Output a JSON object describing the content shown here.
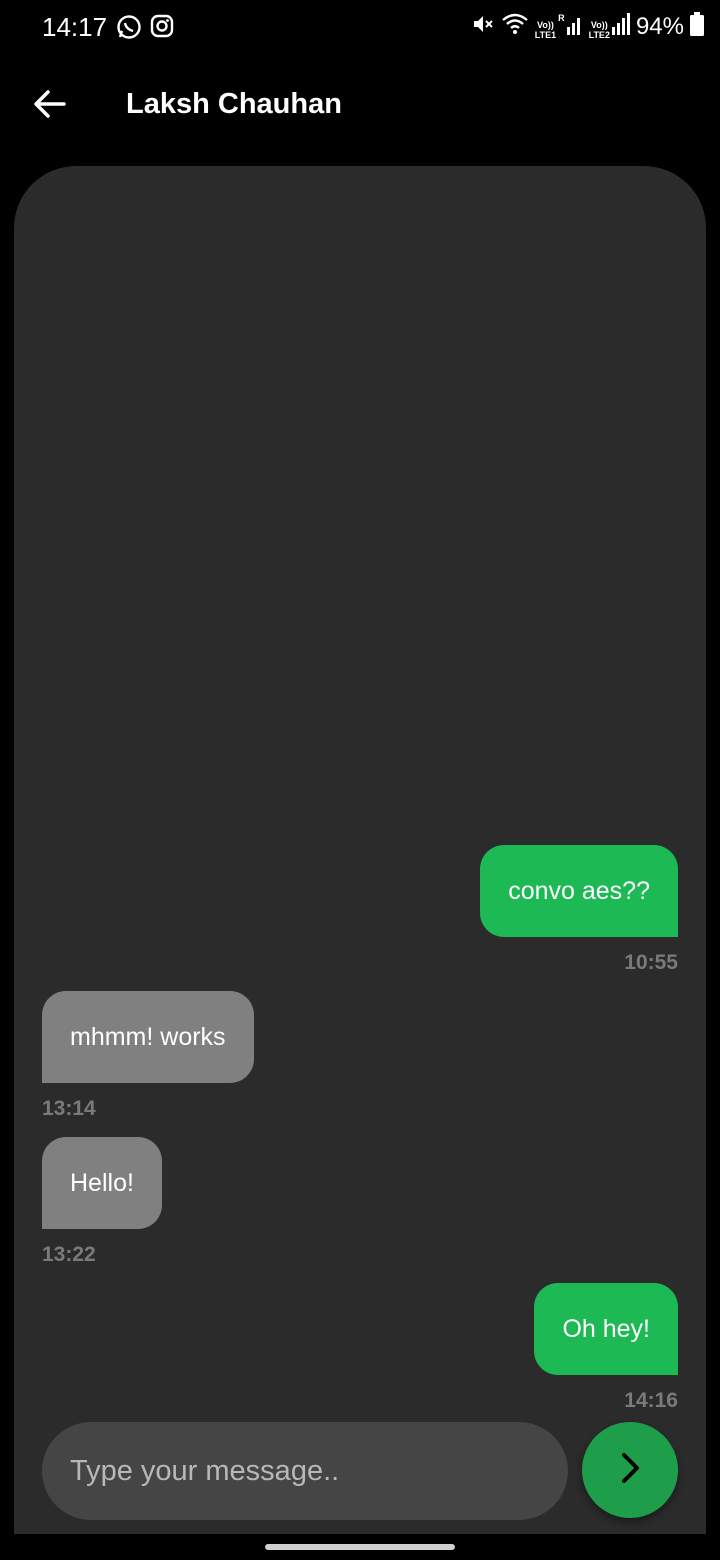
{
  "status_bar": {
    "time": "14:17",
    "app_icons": [
      "whatsapp-icon",
      "instagram-icon"
    ],
    "net1_top": "Vo))",
    "net1_bottom": "LTE1",
    "net1_roaming": "R",
    "net2_top": "Vo))",
    "net2_bottom": "LTE2",
    "battery": "94%"
  },
  "header": {
    "back_icon": "arrow-left-icon",
    "contact_name": "Laksh Chauhan"
  },
  "messages": [
    {
      "direction": "out",
      "text": "convo aes??",
      "time": "10:55"
    },
    {
      "direction": "in",
      "text": "mhmm! works",
      "time": "13:14"
    },
    {
      "direction": "in",
      "text": "Hello!",
      "time": "13:22"
    },
    {
      "direction": "out",
      "text": "Oh hey!",
      "time": "14:16"
    }
  ],
  "composer": {
    "placeholder": "Type your message..",
    "value": "",
    "send_icon": "chevron-right-icon"
  },
  "colors": {
    "background": "#000000",
    "panel": "#2b2b2b",
    "outgoing_bubble": "#1db954",
    "incoming_bubble": "#808080",
    "send_button": "#1e9e4a",
    "input_bg": "#454545"
  }
}
